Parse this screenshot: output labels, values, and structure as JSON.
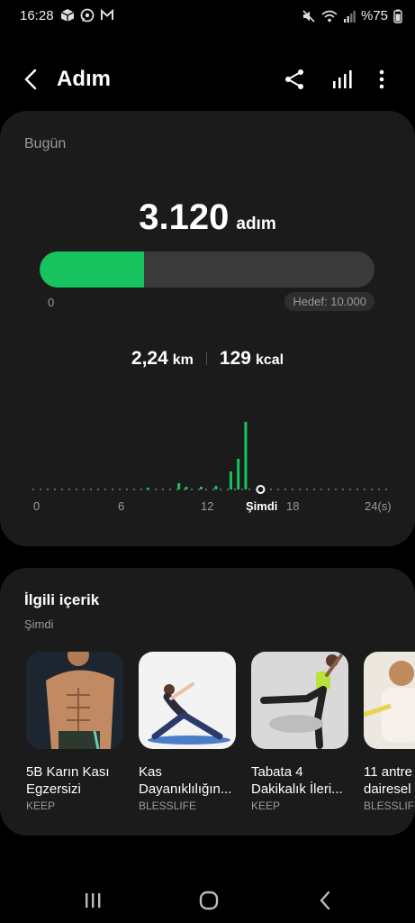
{
  "status": {
    "time": "16:28",
    "battery": "%75"
  },
  "header": {
    "title": "Adım"
  },
  "summary": {
    "period": "Bugün",
    "steps": "3.120",
    "steps_unit": "adım",
    "progress_fraction": 0.312,
    "progress_start": "0",
    "goal": "Hedef: 10.000",
    "distance": "2,24",
    "distance_unit": "km",
    "calories": "129",
    "calories_unit": "kcal",
    "accent": "#16c35f"
  },
  "chart_data": {
    "type": "bar",
    "x_ticks": [
      "0",
      "6",
      "12",
      "Şimdi",
      "18",
      "24(s)"
    ],
    "bars": [
      {
        "hour": 7.7,
        "value": 2
      },
      {
        "hour": 9.8,
        "value": 7
      },
      {
        "hour": 10.3,
        "value": 3
      },
      {
        "hour": 11.3,
        "value": 3
      },
      {
        "hour": 12.3,
        "value": 4
      },
      {
        "hour": 13.3,
        "value": 20
      },
      {
        "hour": 13.8,
        "value": 34
      },
      {
        "hour": 14.3,
        "value": 75
      }
    ],
    "current_hour": 15.3,
    "grid": false
  },
  "related": {
    "title": "İlgili içerik",
    "subtitle": "Şimdi",
    "items": [
      {
        "line1": "5B Karın Kası",
        "line2": "Egzersizi",
        "source": "KEEP",
        "icon": "abs-photo"
      },
      {
        "line1": "Kas",
        "line2": "Dayanıklılığın...",
        "source": "BLESSLIFE",
        "icon": "stretch-photo"
      },
      {
        "line1": "Tabata 4",
        "line2": "Dakikalık İleri...",
        "source": "KEEP",
        "icon": "kick-photo"
      },
      {
        "line1": "11 antre",
        "line2": "dairesel",
        "source": "BLESSLIFE",
        "icon": "gym-photo"
      }
    ]
  }
}
